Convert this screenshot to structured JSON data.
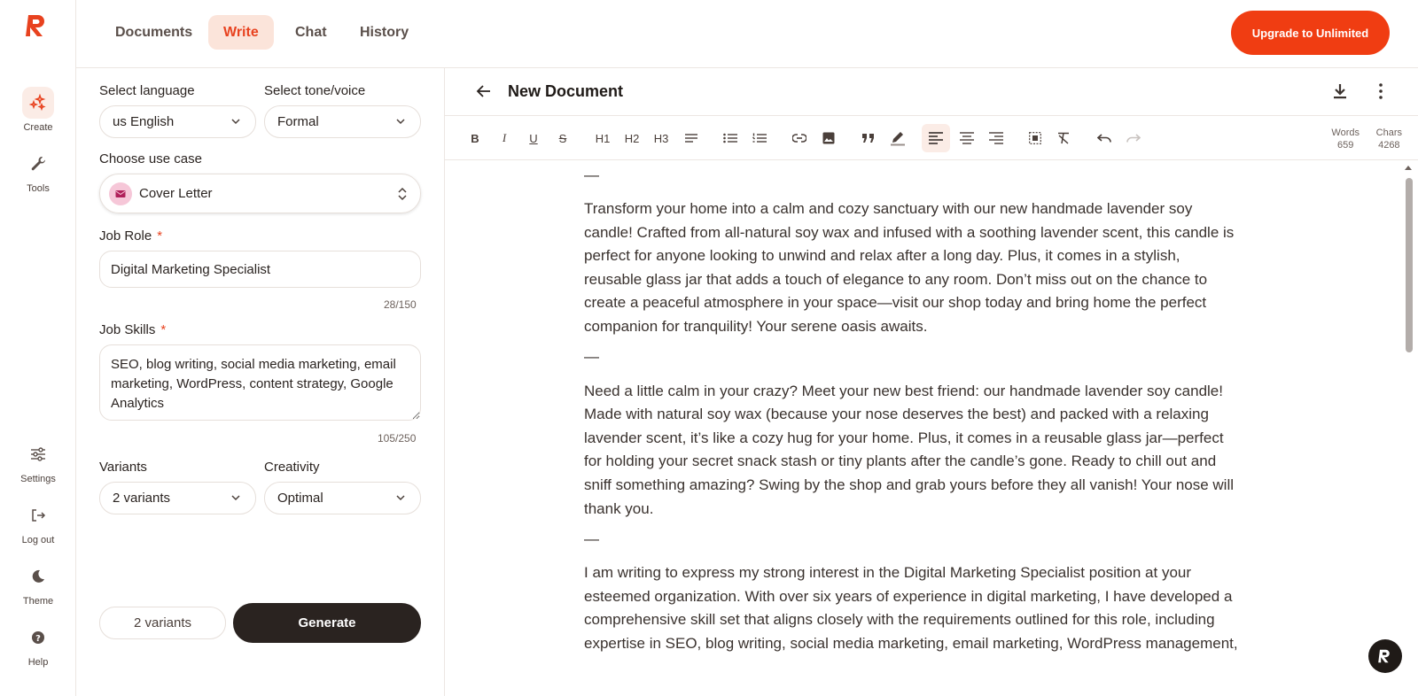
{
  "rail": {
    "items": [
      {
        "label": "Create"
      },
      {
        "label": "Tools"
      },
      {
        "label": "Settings"
      },
      {
        "label": "Log out"
      },
      {
        "label": "Theme"
      },
      {
        "label": "Help"
      }
    ]
  },
  "tabs": [
    "Documents",
    "Write",
    "Chat",
    "History"
  ],
  "upgrade_label": "Upgrade to Unlimited",
  "form": {
    "language_label": "Select language",
    "language_value": "us English",
    "tone_label": "Select tone/voice",
    "tone_value": "Formal",
    "usecase_label": "Choose use case",
    "usecase_value": "Cover Letter",
    "job_role_label": "Job Role",
    "job_role_value": "Digital Marketing Specialist",
    "job_role_counter": "28/150",
    "job_skills_label": "Job Skills",
    "job_skills_value": "SEO, blog writing, social media marketing, email marketing, WordPress, content strategy, Google Analytics",
    "job_skills_counter": "105/250",
    "required_mark": "*",
    "variants_label": "Variants",
    "variants_value": "2 variants",
    "creativity_label": "Creativity",
    "creativity_value": "Optimal",
    "variants_pill": "2 variants",
    "generate_label": "Generate"
  },
  "document": {
    "title": "New Document",
    "toolbar": {
      "bold": "B",
      "italic": "I",
      "underline": "U",
      "strike": "S",
      "h1": "H1",
      "h2": "H2",
      "h3": "H3"
    },
    "words_label": "Words",
    "words_value": "659",
    "chars_label": "Chars",
    "chars_value": "4268",
    "separator": "—",
    "paragraphs": [
      "Transform your home into a calm and cozy sanctuary with our new handmade lavender soy candle! Crafted from all-natural soy wax and infused with a soothing lavender scent, this candle is perfect for anyone looking to unwind and relax after a long day. Plus, it comes in a stylish, reusable glass jar that adds a touch of elegance to any room. Don’t miss out on the chance to create a peaceful atmosphere in your space—visit our shop today and bring home the perfect companion for tranquility! Your serene oasis awaits.",
      "Need a little calm in your crazy? Meet your new best friend: our handmade lavender soy candle! Made with natural soy wax (because your nose deserves the best) and packed with a relaxing lavender scent, it’s like a cozy hug for your home. Plus, it comes in a reusable glass jar—perfect for holding your secret snack stash or tiny plants after the candle’s gone. Ready to chill out and sniff something amazing? Swing by the shop and grab yours before they all vanish! Your nose will thank you.",
      "I am writing to express my strong interest in the Digital Marketing Specialist position at your esteemed organization. With over six years of experience in digital marketing, I have developed a comprehensive skill set that aligns closely with the requirements outlined for this role, including expertise in SEO, blog writing, social media marketing, email marketing, WordPress management,"
    ]
  },
  "colors": {
    "accent": "#f03d12",
    "dark": "#2a2320",
    "active_tab_bg": "#fbe4da"
  }
}
